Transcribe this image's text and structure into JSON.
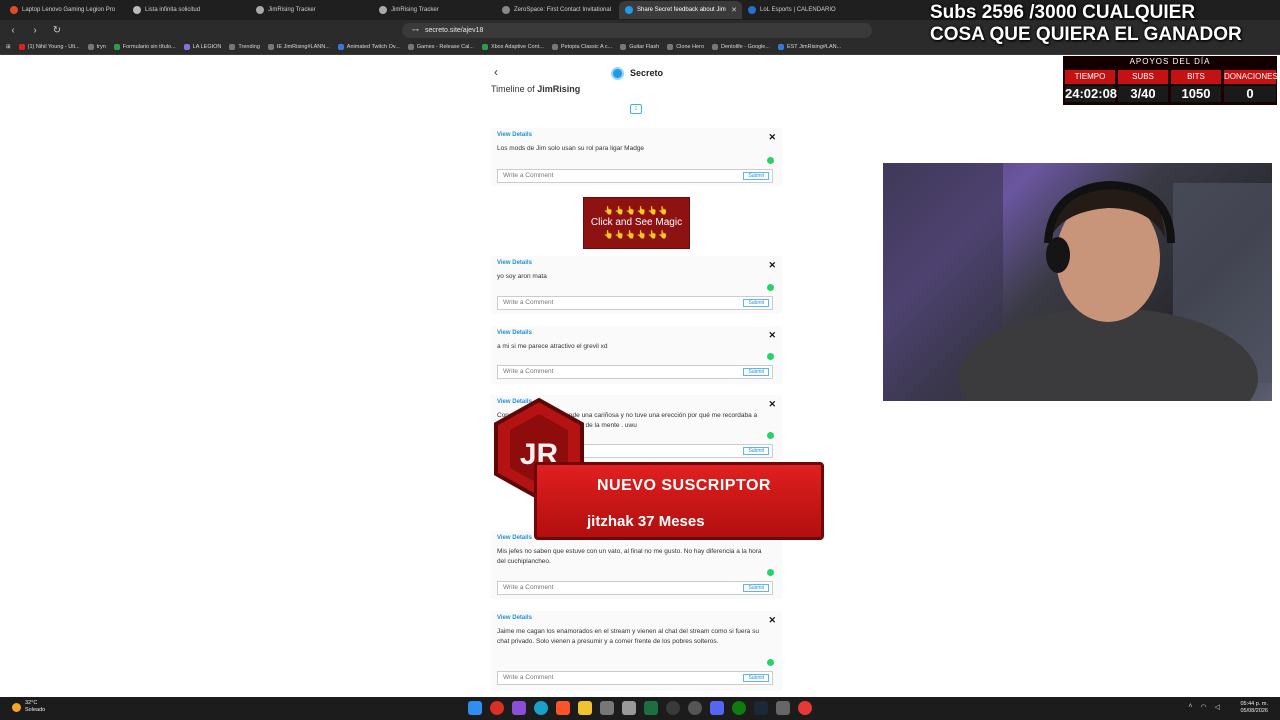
{
  "browser": {
    "tabs": [
      {
        "label": "Laptop Lenovo Gaming Legion Pro",
        "active": false
      },
      {
        "label": "Lista infinita solicitud",
        "active": false
      },
      {
        "label": "JimRising Tracker",
        "active": false
      },
      {
        "label": "JimRising Tracker",
        "active": false
      },
      {
        "label": "ZeroSpace: First Contact Invitational",
        "active": false
      },
      {
        "label": "Share Secret feedback about Jim",
        "active": true
      },
      {
        "label": "LoL Esports | CALENDARIO",
        "active": false
      }
    ],
    "url": "secreto.site/ajev18",
    "bookmarks": [
      "(1) Nihil Young - Ult...",
      "tryn",
      "Formulario sin título...",
      "LA LEGION",
      "Trending",
      "IE JimRising#LANN...",
      "Animated Twitch Ov...",
      "Games - Release Cal...",
      "Xbox Adaptive Cont...",
      "Petopia Classic A c...",
      "Guitar Flash",
      "Clone Hero",
      "Dentolife - Google...",
      "EST JimRising#LAN..."
    ]
  },
  "page": {
    "site_name": "Secreto",
    "timeline_prefix": "Timeline of",
    "timeline_user": "JimRising",
    "page_number": "1",
    "view_details": "View Details",
    "comment_placeholder": "Write a Comment",
    "submit_label": "Submit",
    "posts": [
      {
        "message": "Los mods de Jim solo usan su rol para ligar Madge"
      },
      {
        "message": "yo soy aron mata"
      },
      {
        "message": "a mi si me parece atractivo el grevil xd"
      },
      {
        "message": "Conocí que una chica donde una cariñosa y no tuve una erección por qué me recordaba a Jimena y no me la pude sacar de la mente . uwu"
      },
      {
        "message": "Mis jefes no saben que estuve con un vato, al final no me gusto. No hay diferencia a la hora del cuchiplancheo."
      },
      {
        "message": "Jaime me cagan los enamorados en el stream y vienen al chat del stream como si fuera su chat privado. Solo vienen a presumir y a comer frente de los pobres solteros."
      }
    ],
    "ad": {
      "hands": "👆👆👆👆👆👆",
      "text": "Click and See Magic",
      "hands_bottom": "👆👆👆👆👆👆"
    }
  },
  "overlay": {
    "goal_line1": "Subs 2596 /3000 CUALQUIER",
    "goal_line2": "COSA QUE QUIERA EL GANADOR",
    "apoyos": "APOYOS DEL DÍA",
    "headers": [
      "TIEMPO",
      "SUBS",
      "BITS",
      "DONACIONES"
    ],
    "values": [
      "24:02:08",
      "3/40",
      "1050",
      "0"
    ],
    "sub_alert_title": "NUEVO SUSCRIPTOR",
    "sub_alert_name": "jitzhak 37 Meses"
  },
  "taskbar": {
    "temp": "32°C",
    "weather": "Soleado",
    "time": "05:44 p. m.",
    "date": "05/08/2026"
  },
  "colors": {
    "accent": "#2290d8",
    "alert_red": "#d01818",
    "whatsapp": "#25d366"
  }
}
